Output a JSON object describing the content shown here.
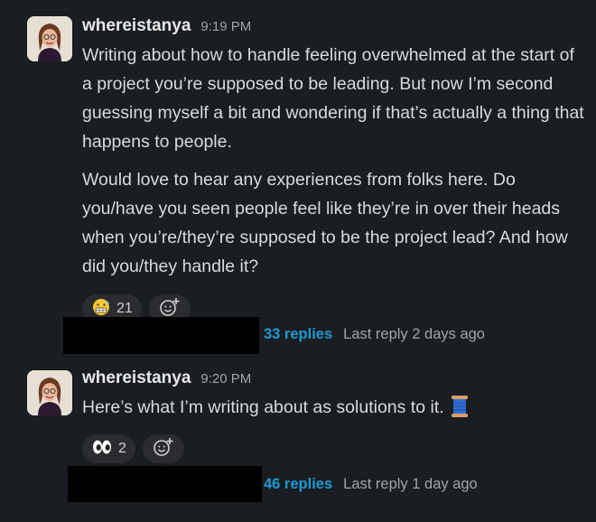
{
  "messages": [
    {
      "username": "whereistanya",
      "time": "9:19 PM",
      "paragraphs": [
        "Writing about how to handle feeling overwhelmed at the start of a project you’re supposed to be leading. But now I’m second guessing myself a bit and wondering if that’s actually a thing that happens to people.",
        "Would love to hear any experiences from folks here. Do you/have you seen people feel like they’re in over their heads when you’re/they’re supposed to be the project lead? And how did you/they handle it?"
      ],
      "reactions": [
        {
          "icon": "grimacing-sweat-emoji",
          "count": "21"
        }
      ],
      "thread": {
        "replies": "33 replies",
        "last_reply": "Last reply 2 days ago"
      }
    },
    {
      "username": "whereistanya",
      "time": "9:20 PM",
      "paragraphs": [
        "Here’s what I’m writing about as solutions to it."
      ],
      "trailing_icon": "thread-spool-emoji",
      "reactions": [
        {
          "icon": "eyes-emoji",
          "count": "2"
        }
      ],
      "thread": {
        "replies": "46 replies",
        "last_reply": "Last reply 1 day ago"
      }
    }
  ],
  "icons": {
    "add_reaction": "add-reaction-icon"
  },
  "colors": {
    "background": "#1a1d21",
    "link": "#1d9bd1",
    "pill": "#2a2c30"
  }
}
